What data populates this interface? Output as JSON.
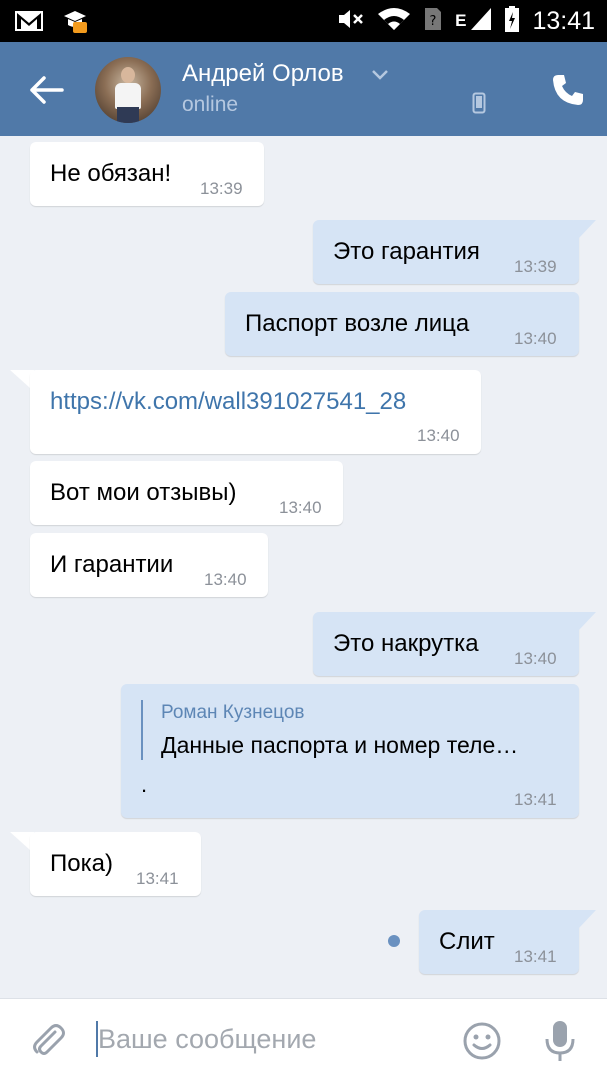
{
  "status_bar": {
    "time": "13:41",
    "network_letter": "E",
    "icons": [
      "gmail-icon",
      "notification-icon",
      "mute-icon",
      "wifi-icon",
      "sim-icon",
      "signal-icon",
      "battery-icon"
    ]
  },
  "header": {
    "name": "Андрей Орлов",
    "status": "online",
    "accent": "#5079a8"
  },
  "messages": [
    {
      "dir": "in",
      "text": "Не обязан!",
      "time": "13:39"
    },
    {
      "dir": "out",
      "text": "Это гарантия",
      "time": "13:39"
    },
    {
      "dir": "out",
      "text": "Паспорт возле лица",
      "time": "13:40"
    },
    {
      "dir": "in",
      "text": "https://vk.com/wall391027541_28",
      "time": "13:40",
      "is_link": true
    },
    {
      "dir": "in",
      "text": "Вот мои отзывы)",
      "time": "13:40"
    },
    {
      "dir": "in",
      "text": "И гарантии",
      "time": "13:40"
    },
    {
      "dir": "out",
      "text": "Это накрутка",
      "time": "13:40"
    },
    {
      "dir": "out",
      "quote_author": "Роман Кузнецов",
      "quote_text": "Данные паспорта и номер теле…",
      "text": ".",
      "time": "13:41"
    },
    {
      "dir": "in",
      "text": "Пока)",
      "time": "13:41"
    },
    {
      "dir": "out",
      "text": "Слит",
      "time": "13:41",
      "unread": true
    }
  ],
  "input": {
    "placeholder": "Ваше сообщение",
    "value": ""
  }
}
